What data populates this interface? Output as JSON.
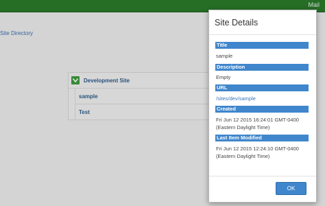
{
  "topbar": {
    "mail_label": "Mail"
  },
  "breadcrumb": "Site Directory",
  "tree": {
    "root_label": "Development Site",
    "children": [
      "sample",
      "Test"
    ]
  },
  "modal": {
    "title": "Site Details",
    "fields": [
      {
        "label": "Title",
        "value": "sample"
      },
      {
        "label": "Description",
        "value": "Empty"
      },
      {
        "label": "URL",
        "value": "/sites/dev/sample"
      },
      {
        "label": "Created",
        "value_line1": "Fri Jun 12 2015 16:24:01 GMT-0400",
        "value_line2": "(Eastern Daylight Time)"
      },
      {
        "label": "Last Item Modified",
        "value_line1": "Fri Jun 12 2015 12:24:10 GMT-0400",
        "value_line2": "(Eastern Daylight Time)"
      }
    ],
    "ok_label": "OK"
  },
  "colors": {
    "topbar": "#2b7a2b",
    "accent": "#3f86cc",
    "chevron": "#3e9a3e"
  }
}
